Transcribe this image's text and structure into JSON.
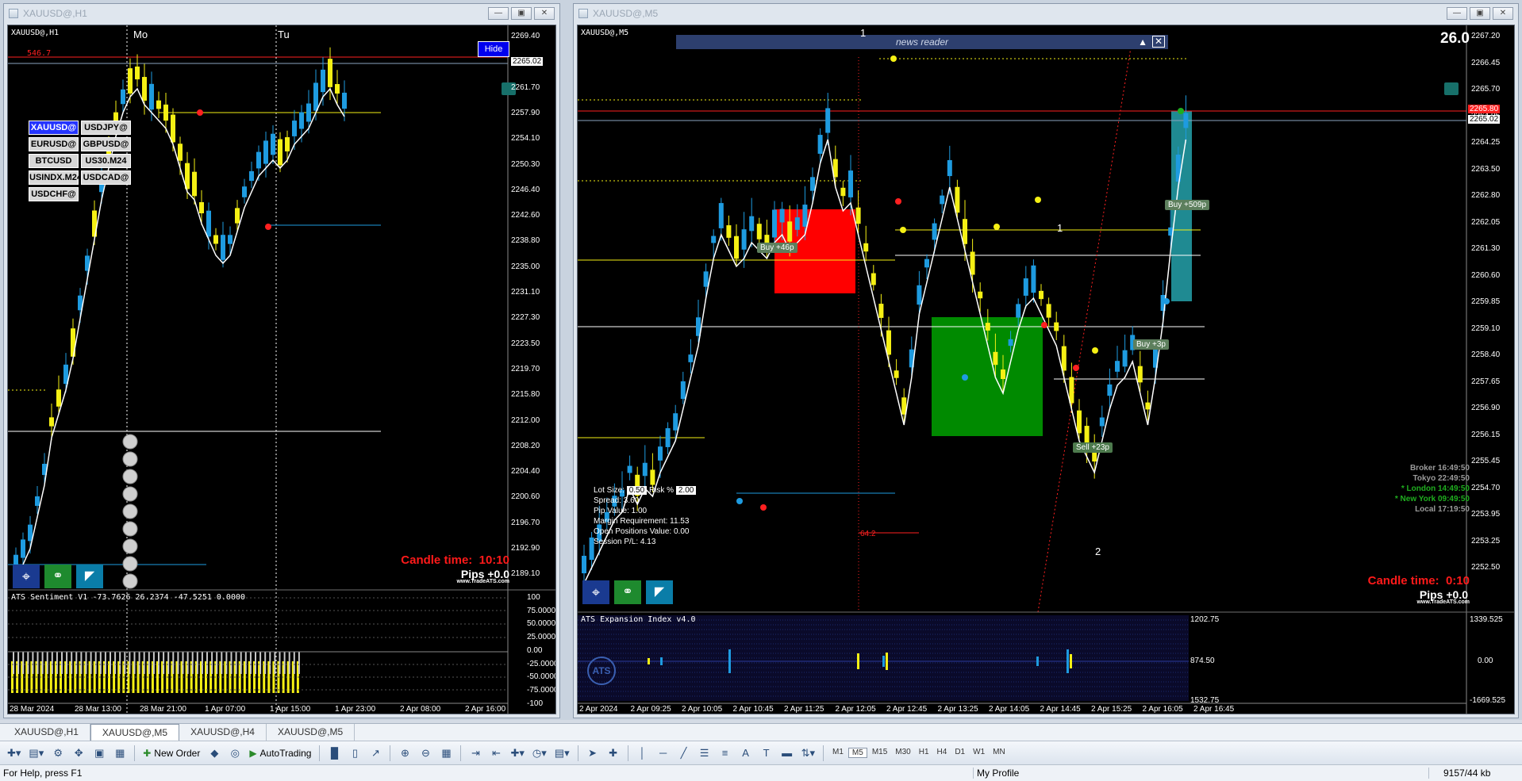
{
  "windows": [
    {
      "title": "XAUUSD@,H1",
      "chart_label": "XAUUSD@,H1",
      "hide_button": "Hide",
      "red_level": "546.7",
      "day_labels": [
        "Mo",
        "Tu"
      ],
      "symbol_buttons": [
        "XAUUSD@",
        "USDJPY@",
        "EURUSD@",
        "GBPUSD@",
        "BTCUSD",
        "US30.M24",
        "USINDX.M24",
        "USDCAD@",
        "USDCHF@"
      ],
      "price_axis": [
        "2269.40",
        "2265.02",
        "2261.70",
        "2257.90",
        "2254.10",
        "2250.30",
        "2246.40",
        "2242.60",
        "2238.80",
        "2235.00",
        "2231.10",
        "2227.30",
        "2223.50",
        "2219.70",
        "2215.80",
        "2212.00",
        "2208.20",
        "2204.40",
        "2200.60",
        "2196.70",
        "2192.90",
        "2189.10"
      ],
      "time_axis": [
        "28 Mar 2024",
        "28 Mar 13:00",
        "28 Mar 21:00",
        "1 Apr 07:00",
        "1 Apr 15:00",
        "1 Apr 23:00",
        "2 Apr 08:00",
        "2 Apr 16:00"
      ],
      "candle_time_label": "Candle time:",
      "candle_time_value": "10:10",
      "pips": "Pips +0.0",
      "brand": "www.TradeATS.com",
      "indicator_title": "ATS Sentiment V1 -73.7626 26.2374 -47.5251 0.0000",
      "indicator_axis": [
        "100",
        "75.0000",
        "50.0000",
        "25.0000",
        "0.00",
        "-25.0000",
        "-50.0000",
        "-75.0000",
        "-100"
      ]
    },
    {
      "title": "XAUUSD@,M5",
      "chart_label": "XAUUSD@,M5",
      "news_reader": "news reader",
      "top_value": "26.0",
      "price_axis": [
        "2267.20",
        "2266.45",
        "2265.70",
        "2264.95",
        "2264.25",
        "2263.50",
        "2262.80",
        "2262.05",
        "2261.30",
        "2260.60",
        "2259.85",
        "2259.10",
        "2258.40",
        "2257.65",
        "2256.90",
        "2256.15",
        "2255.45",
        "2254.70",
        "2253.95",
        "2253.25",
        "2252.50"
      ],
      "price_tags": [
        "2265.80",
        "2265.02"
      ],
      "time_axis": [
        "2 Apr 2024",
        "2 Apr 09:25",
        "2 Apr 10:05",
        "2 Apr 10:45",
        "2 Apr 11:25",
        "2 Apr 12:05",
        "2 Apr 12:45",
        "2 Apr 13:25",
        "2 Apr 14:05",
        "2 Apr 14:45",
        "2 Apr 15:25",
        "2 Apr 16:05",
        "2 Apr 16:45"
      ],
      "wave_labels": [
        "1",
        "1",
        "2"
      ],
      "trade_labels": [
        "Buy +46p",
        "Buy +509p",
        "Buy +3p",
        "Sell +23p"
      ],
      "red_note": "64.2",
      "panel": {
        "lot_size_label": "Lot Size:",
        "lot_size_value": "0.50",
        "risk_label": "Risk %",
        "risk_value": "2.00",
        "spread": "Spread: 3.60",
        "pip_value": "Pip Value: 1.00",
        "margin": "Margin Requirement: 11.53",
        "open_positions": "Open Positions Value: 0.00",
        "session_pl": "Session P/L: 4.13"
      },
      "sessions": [
        {
          "name": "Broker",
          "time": "16:49:50",
          "color": "#9a9a9a"
        },
        {
          "name": "Tokyo",
          "time": "22:49:50",
          "color": "#9a9a9a"
        },
        {
          "name": "* London",
          "time": "14:49:50",
          "color": "#1fae1f"
        },
        {
          "name": "* New York",
          "time": "09:49:50",
          "color": "#1fae1f"
        },
        {
          "name": "Local",
          "time": "17:19:50",
          "color": "#9a9a9a"
        }
      ],
      "candle_time_label": "Candle time:",
      "candle_time_value": "0:10",
      "pips": "Pips +0.0",
      "brand": "www.TradeATS.com",
      "indicator_title": "ATS Expansion Index v4.0",
      "indicator_levels": [
        "1202.75",
        "874.50",
        "1532.75"
      ],
      "indicator_axis": [
        "1339.525",
        "0.00",
        "-1669.525"
      ],
      "ats_logo": "ATS"
    }
  ],
  "tabs": [
    "XAUUSD@,H1",
    "XAUUSD@,M5",
    "XAUUSD@,H4",
    "XAUUSD@,M5"
  ],
  "active_tab": 1,
  "toolbar": {
    "new_order": "New Order",
    "autotrading": "AutoTrading",
    "timeframes": [
      "M1",
      "M5",
      "M15",
      "M30",
      "H1",
      "H4",
      "D1",
      "W1",
      "MN"
    ],
    "active_tf": "M5"
  },
  "status": {
    "help": "For Help, press F1",
    "profile": "My Profile",
    "traffic": "9157/44 kb"
  },
  "colors": {
    "bull": "#1e9be0",
    "bear": "#f5f014",
    "chart_bg": "#000000",
    "red_zone": "#ff0000",
    "green_zone": "#008a00",
    "teal_zone": "#1f8a92"
  }
}
